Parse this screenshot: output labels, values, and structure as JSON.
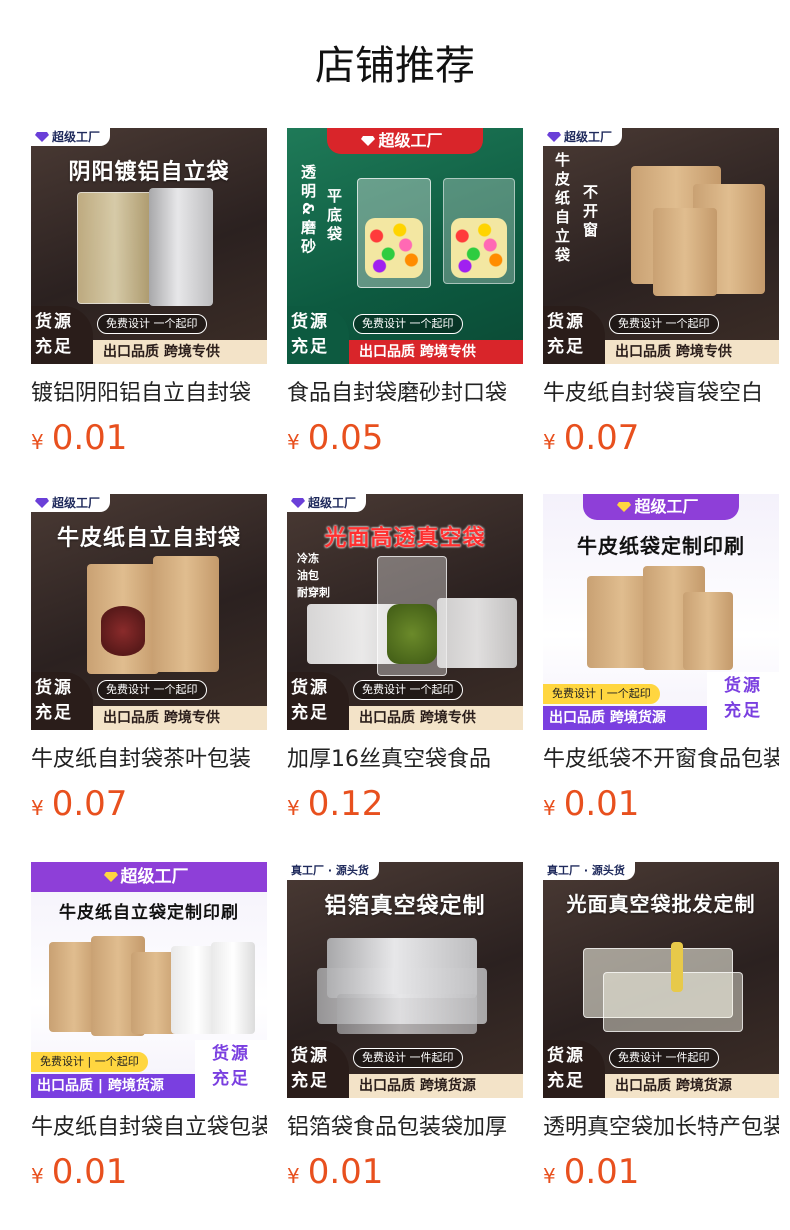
{
  "page": {
    "title": "店铺推荐"
  },
  "products": [
    {
      "title": "镀铝阴阳铝自立自封袋",
      "currency": "¥",
      "price": "0.01",
      "image": {
        "badge": "超级工厂",
        "headline": "阴阳镀铝自立袋",
        "promo_pill": "免费设计  一个起印",
        "promo_source": [
          "货源",
          "充足"
        ],
        "promo_strip": "出口品质  跨境专供"
      }
    },
    {
      "title": "食品自封袋磨砂封口袋",
      "currency": "¥",
      "price": "0.05",
      "image": {
        "badge": "超级工厂",
        "side_left": "透明&磨砂",
        "side_right": "平底袋",
        "promo_pill": "免费设计  一个起印",
        "promo_source": [
          "货源",
          "充足"
        ],
        "promo_strip": "出口品质  跨境专供"
      }
    },
    {
      "title": "牛皮纸自封袋盲袋空白",
      "currency": "¥",
      "price": "0.07",
      "image": {
        "badge": "超级工厂",
        "side_left": "牛皮纸自立袋",
        "side_right": "不开窗",
        "promo_pill": "免费设计  一个起印",
        "promo_source": [
          "货源",
          "充足"
        ],
        "promo_strip": "出口品质  跨境专供"
      }
    },
    {
      "title": "牛皮纸自封袋茶叶包装",
      "currency": "¥",
      "price": "0.07",
      "image": {
        "badge": "超级工厂",
        "headline": "牛皮纸自立自封袋",
        "promo_pill": "免费设计  一个起印",
        "promo_source": [
          "货源",
          "充足"
        ],
        "promo_strip": "出口品质  跨境专供"
      }
    },
    {
      "title": "加厚16丝真空袋食品",
      "currency": "¥",
      "price": "0.12",
      "image": {
        "badge": "超级工厂",
        "headline": "光面高透真空袋",
        "note_lines": [
          "冷冻",
          "油包",
          "耐穿刺"
        ],
        "promo_pill": "免费设计  一个起印",
        "promo_source": [
          "货源",
          "充足"
        ],
        "promo_strip": "出口品质  跨境专供"
      }
    },
    {
      "title": "牛皮纸袋不开窗食品包装",
      "currency": "¥",
      "price": "0.01",
      "image": {
        "badge": "超级工厂",
        "headline": "牛皮纸袋定制印刷",
        "promo_pill": "免费设计  |  一个起印",
        "promo_source": [
          "货源",
          "充足"
        ],
        "promo_strip": "出口品质  跨境货源"
      }
    },
    {
      "title": "牛皮纸自封袋自立袋包装",
      "currency": "¥",
      "price": "0.01",
      "image": {
        "badge": "超级工厂",
        "headline": "牛皮纸自立袋定制印刷",
        "promo_pill": "免费设计  |  一个起印",
        "promo_source": [
          "货源",
          "充足"
        ],
        "promo_strip": "出口品质 | 跨境货源"
      }
    },
    {
      "title": "铝箔袋食品包装袋加厚",
      "currency": "¥",
      "price": "0.01",
      "image": {
        "badge": "真工厂 · 源头货",
        "headline": "铝箔真空袋定制",
        "promo_pill": "免费设计  一件起印",
        "promo_source": [
          "货源",
          "充足"
        ],
        "promo_strip": "出口品质  跨境货源"
      }
    },
    {
      "title": "透明真空袋加长特产包装",
      "currency": "¥",
      "price": "0.01",
      "image": {
        "badge": "真工厂 · 源头货",
        "headline": "光面真空袋批发定制",
        "promo_pill": "免费设计  一件起印",
        "promo_source": [
          "货源",
          "充足"
        ],
        "promo_strip": "出口品质  跨境货源"
      }
    }
  ]
}
